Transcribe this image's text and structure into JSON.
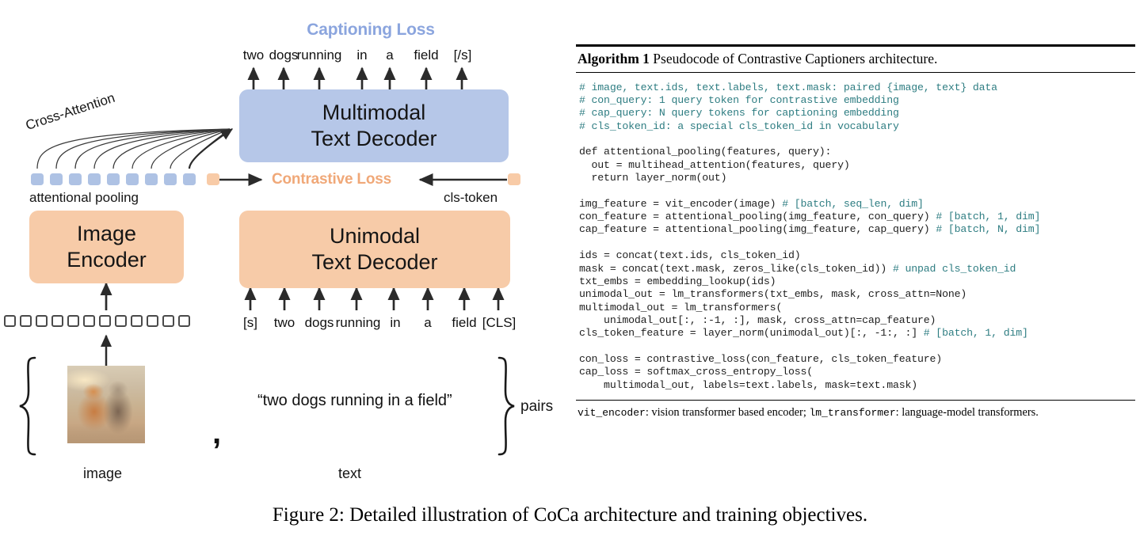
{
  "figure": {
    "caption": "Figure 2: Detailed illustration of CoCa architecture and training objectives."
  },
  "diagram": {
    "captioning_loss_label": "Captioning Loss",
    "contrastive_loss_label": "Contrastive Loss",
    "cross_attention_label": "Cross-Attention",
    "attentional_pooling_label": "attentional pooling",
    "cls_token_label": "cls-token",
    "image_label": "image",
    "text_label": "text",
    "pairs_label": "pairs",
    "caption_quote": "“two dogs running in a field”",
    "comma": ",",
    "multimodal_decoder": {
      "line1": "Multimodal",
      "line2": "Text Decoder"
    },
    "unimodal_decoder": {
      "line1": "Unimodal",
      "line2": "Text Decoder"
    },
    "image_encoder": {
      "line1": "Image",
      "line2": "Encoder"
    },
    "output_tokens": [
      "two",
      "dogs",
      "running",
      "in",
      "a",
      "field",
      "[/s]"
    ],
    "input_tokens": [
      "[s]",
      "two",
      "dogs",
      "running",
      "in",
      "a",
      "field",
      "[CLS]"
    ],
    "pool_squares_blue_count": 9,
    "pool_squares_orange_count": 1,
    "patch_squares_count": 12,
    "colors": {
      "blue_box": "#b6c7e8",
      "orange_box": "#f7cba8",
      "captioning_loss_text": "#8ba5de",
      "contrastive_loss_text": "#f0a878",
      "arrow": "#2b2b2b"
    }
  },
  "algorithm": {
    "title_bold": "Algorithm 1",
    "title_rest": " Pseudocode of Contrastive Captioners architecture.",
    "code_lines": [
      {
        "parts": [
          {
            "t": "# image, text.ids, text.labels, text.mask: paired {image, text} data",
            "c": "cmt"
          }
        ]
      },
      {
        "parts": [
          {
            "t": "# con_query: 1 query token for contrastive embedding",
            "c": "cmt"
          }
        ]
      },
      {
        "parts": [
          {
            "t": "# cap_query: N query tokens for captioning embedding",
            "c": "cmt"
          }
        ]
      },
      {
        "parts": [
          {
            "t": "# cls_token_id: a special cls_token_id in vocabulary",
            "c": "cmt"
          }
        ]
      },
      {
        "parts": [
          {
            "t": "",
            "c": ""
          }
        ]
      },
      {
        "parts": [
          {
            "t": "def attentional_pooling(features, query):",
            "c": ""
          }
        ]
      },
      {
        "parts": [
          {
            "t": "  out = multihead_attention(features, query)",
            "c": ""
          }
        ]
      },
      {
        "parts": [
          {
            "t": "  return layer_norm(out)",
            "c": ""
          }
        ]
      },
      {
        "parts": [
          {
            "t": "",
            "c": ""
          }
        ]
      },
      {
        "parts": [
          {
            "t": "img_feature = vit_encoder(image) ",
            "c": ""
          },
          {
            "t": "# [batch, seq_len, dim]",
            "c": "cmt"
          }
        ]
      },
      {
        "parts": [
          {
            "t": "con_feature = attentional_pooling(img_feature, con_query) ",
            "c": ""
          },
          {
            "t": "# [batch, 1, dim]",
            "c": "cmt"
          }
        ]
      },
      {
        "parts": [
          {
            "t": "cap_feature = attentional_pooling(img_feature, cap_query) ",
            "c": ""
          },
          {
            "t": "# [batch, N, dim]",
            "c": "cmt"
          }
        ]
      },
      {
        "parts": [
          {
            "t": "",
            "c": ""
          }
        ]
      },
      {
        "parts": [
          {
            "t": "ids = concat(text.ids, cls_token_id)",
            "c": ""
          }
        ]
      },
      {
        "parts": [
          {
            "t": "mask = concat(text.mask, zeros_like(cls_token_id)) ",
            "c": ""
          },
          {
            "t": "# unpad cls_token_id",
            "c": "cmt"
          }
        ]
      },
      {
        "parts": [
          {
            "t": "txt_embs = embedding_lookup(ids)",
            "c": ""
          }
        ]
      },
      {
        "parts": [
          {
            "t": "unimodal_out = lm_transformers(txt_embs, mask, cross_attn=None)",
            "c": ""
          }
        ]
      },
      {
        "parts": [
          {
            "t": "multimodal_out = lm_transformers(",
            "c": ""
          }
        ]
      },
      {
        "parts": [
          {
            "t": "    unimodal_out[:, :-1, :], mask, cross_attn=cap_feature)",
            "c": ""
          }
        ]
      },
      {
        "parts": [
          {
            "t": "cls_token_feature = layer_norm(unimodal_out)[:, -1:, :] ",
            "c": ""
          },
          {
            "t": "# [batch, 1, dim]",
            "c": "cmt"
          }
        ]
      },
      {
        "parts": [
          {
            "t": "",
            "c": ""
          }
        ]
      },
      {
        "parts": [
          {
            "t": "con_loss = contrastive_loss(con_feature, cls_token_feature)",
            "c": ""
          }
        ]
      },
      {
        "parts": [
          {
            "t": "cap_loss = softmax_cross_entropy_loss(",
            "c": ""
          }
        ]
      },
      {
        "parts": [
          {
            "t": "    multimodal_out, labels=text.labels, mask=text.mask)",
            "c": ""
          }
        ]
      }
    ],
    "footnote": [
      {
        "t": "vit_encoder",
        "mono": true
      },
      {
        "t": ": vision transformer based encoder; ",
        "mono": false
      },
      {
        "t": "lm_transformer",
        "mono": true
      },
      {
        "t": ": language-model transformers.",
        "mono": false
      }
    ]
  }
}
